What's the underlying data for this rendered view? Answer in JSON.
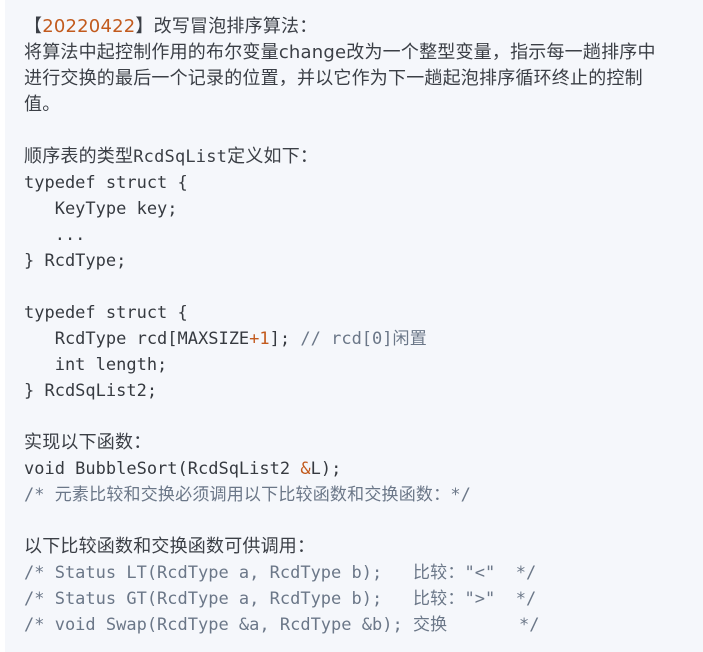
{
  "problem": {
    "bracket_open": "【",
    "date": "20220422",
    "bracket_close": "】",
    "title": "改写冒泡排序算法：",
    "desc_line1": "将算法中起控制作用的布尔变量",
    "desc_change": "change",
    "desc_line1_rest": "改为一个整型变量，指示每一趟排序中",
    "desc_line2": "进行交换的最后一个记录的位置，并以它作为下一趟起泡排序循环终止的控制",
    "desc_line3": "值。"
  },
  "type_def": {
    "intro_prefix": "顺序表的类型",
    "intro_type": "RcdSqList",
    "intro_suffix": "定义如下：",
    "struct1": {
      "l1": "typedef struct {",
      "l2": "   KeyType key;",
      "l3": "   ...",
      "l4": "} RcdType;"
    },
    "struct2": {
      "l1": "typedef struct {",
      "l2_a": "   RcdType rcd[MAXSIZE",
      "l2_plus": "+",
      "l2_num": "1",
      "l2_b": "]; ",
      "l2_cmt_a": "// rcd[0]",
      "l2_cmt_b": "闲置",
      "l3": "   int length;",
      "l4": "} RcdSqList2;"
    }
  },
  "function": {
    "intro": "实现以下函数：",
    "sig_a": "void BubbleSort(RcdSqList2 ",
    "sig_amp": "&",
    "sig_b": "L);",
    "note_a": "/* ",
    "note_b": "元素比较和交换必须调用以下比较函数和交换函数：",
    "note_c": "*/"
  },
  "helpers": {
    "intro": "以下比较函数和交换函数可供调用：",
    "lt_code": "/* Status LT(RcdType a, RcdType b);   ",
    "lt_desc": "比较：",
    "lt_sym": "\"<\"  */",
    "gt_code": "/* Status GT(RcdType a, RcdType b);   ",
    "gt_desc": "比较：",
    "gt_sym": "\">\"  */",
    "swap_code": "/* void Swap(RcdType &a, RcdType &b); ",
    "swap_desc": "交换",
    "swap_end": "       */"
  }
}
